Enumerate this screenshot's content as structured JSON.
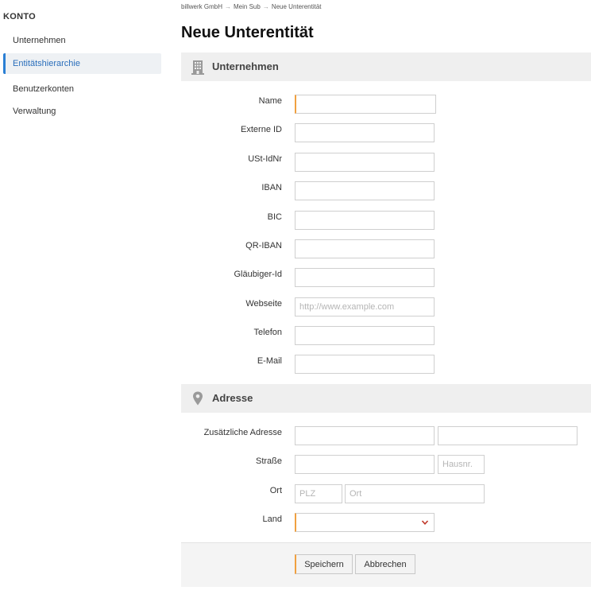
{
  "sidebar": {
    "heading": "KONTO",
    "items": [
      {
        "label": "Unternehmen"
      },
      {
        "label": "Entitätshierarchie"
      },
      {
        "label": "Benutzerkonten"
      },
      {
        "label": "Verwaltung"
      }
    ],
    "active_item": "Entitätshierarchie"
  },
  "breadcrumb": [
    "billwerk GmbH",
    "Mein Sub",
    "Neue Unterentität"
  ],
  "breadcrumb_separator": "→",
  "page": {
    "title": "Neue Unterentität"
  },
  "company_section": {
    "title": "Unternehmen",
    "icon": "building-icon",
    "fields": {
      "name": {
        "label": "Name",
        "value": "",
        "required": true
      },
      "external_id": {
        "label": "Externe ID",
        "value": ""
      },
      "vat_id": {
        "label": "USt-IdNr",
        "value": ""
      },
      "iban": {
        "label": "IBAN",
        "value": ""
      },
      "bic": {
        "label": "BIC",
        "value": ""
      },
      "qr_iban": {
        "label": "QR-IBAN",
        "value": ""
      },
      "creditor_id": {
        "label": "Gläubiger-Id",
        "value": ""
      },
      "website": {
        "label": "Webseite",
        "value": "",
        "placeholder": "http://www.example.com"
      },
      "phone": {
        "label": "Telefon",
        "value": ""
      },
      "email": {
        "label": "E-Mail",
        "value": ""
      }
    }
  },
  "address_section": {
    "title": "Adresse",
    "icon": "map-pin-icon",
    "fields": {
      "additional_address": {
        "label": "Zusätzliche Adresse"
      },
      "street": {
        "label": "Straße",
        "house_number_placeholder": "Hausnr."
      },
      "city": {
        "label": "Ort",
        "zip_placeholder": "PLZ",
        "city_placeholder": "Ort"
      },
      "country": {
        "label": "Land",
        "selected": "",
        "required": true
      }
    }
  },
  "actions": {
    "save_label": "Speichern",
    "cancel_label": "Abbrechen"
  },
  "colors": {
    "accent": "#2a7fd4",
    "required_marker": "#f0a040",
    "dropdown_chevron": "#c0392b",
    "section_bg": "#efefef"
  }
}
